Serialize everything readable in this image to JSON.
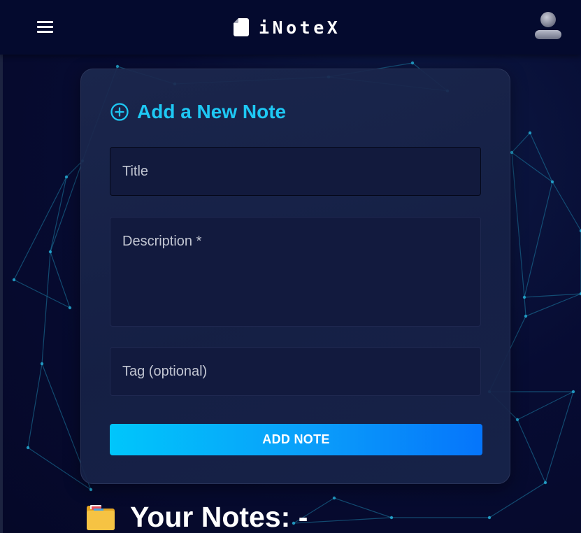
{
  "navbar": {
    "brand": "iNoteX",
    "menu_icon": "hamburger-menu-icon",
    "brand_icon": "note-file-icon",
    "avatar_icon": "user-avatar-icon"
  },
  "add_note_form": {
    "heading": "Add a New Note",
    "heading_icon": "plus-circle-icon",
    "title_placeholder": "Title",
    "description_placeholder": "Description *",
    "tag_placeholder": "Tag (optional)",
    "submit_label": "ADD NOTE"
  },
  "notes_section": {
    "heading": "Your Notes: -",
    "icon": "folder-icon"
  },
  "colors": {
    "accent": "#1ec8f4",
    "button_gradient_start": "#00c6fb",
    "button_gradient_end": "#0575fb",
    "navbar_bg": "#040a2e",
    "page_bg": "#06092a"
  }
}
